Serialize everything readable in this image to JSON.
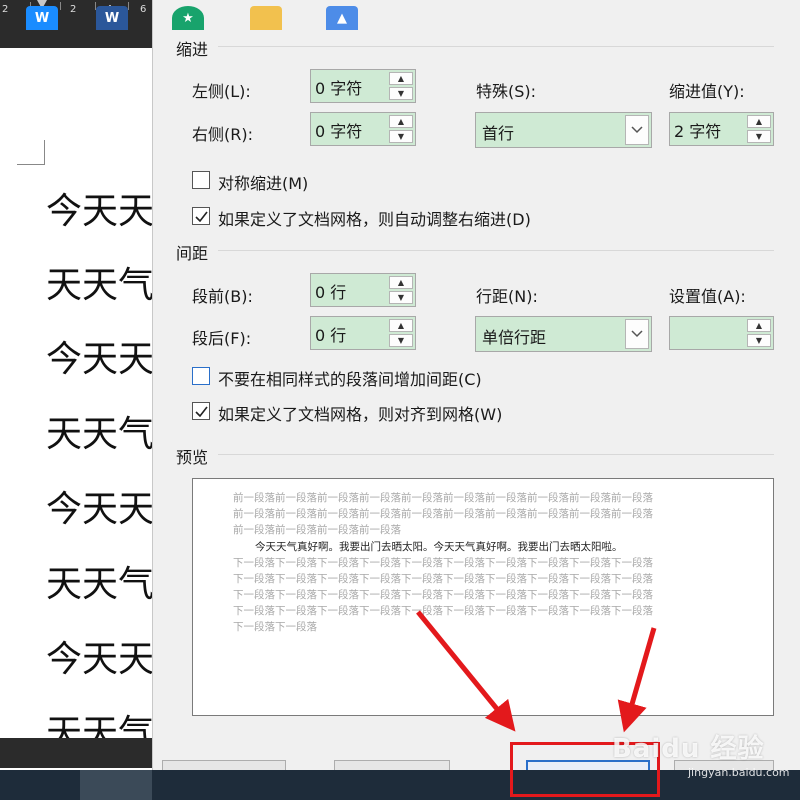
{
  "ruler": {
    "ticks": [
      "2",
      "2",
      "4",
      "6"
    ]
  },
  "document": {
    "lines": [
      "今天天",
      "天天气",
      "今天天",
      "天天气",
      "今天天",
      "天天气",
      "今天天",
      "天天气"
    ]
  },
  "indent": {
    "section_title": "缩进",
    "left_label": "左侧(L):",
    "left_value": "0 字符",
    "right_label": "右侧(R):",
    "right_value": "0 字符",
    "special_label": "特殊(S):",
    "special_value": "首行",
    "indent_value_label": "缩进值(Y):",
    "indent_value": "2 字符",
    "mirror_label": "对称缩进(M)",
    "mirror_checked": false,
    "auto_adjust_label": "如果定义了文档网格，则自动调整右缩进(D)",
    "auto_adjust_checked": true
  },
  "spacing": {
    "section_title": "间距",
    "before_label": "段前(B):",
    "before_value": "0 行",
    "after_label": "段后(F):",
    "after_value": "0 行",
    "line_spacing_label": "行距(N):",
    "line_spacing_value": "单倍行距",
    "setting_label": "设置值(A):",
    "setting_value": "",
    "no_space_label": "不要在相同样式的段落间增加间距(C)",
    "no_space_checked": false,
    "snap_grid_label": "如果定义了文档网格，则对齐到网格(W)",
    "snap_grid_checked": true
  },
  "preview": {
    "section_title": "预览",
    "prev_lines": [
      "前一段落前一段落前一段落前一段落前一段落前一段落前一段落前一段落前一段落前一段落",
      "前一段落前一段落前一段落前一段落前一段落前一段落前一段落前一段落前一段落前一段落",
      "前一段落前一段落前一段落前一段落"
    ],
    "main_line": "今天天气真好啊。我要出门去晒太阳。今天天气真好啊。我要出门去晒太阳啦。",
    "next_lines": [
      "下一段落下一段落下一段落下一段落下一段落下一段落下一段落下一段落下一段落下一段落",
      "下一段落下一段落下一段落下一段落下一段落下一段落下一段落下一段落下一段落下一段落",
      "下一段落下一段落下一段落下一段落下一段落下一段落下一段落下一段落下一段落下一段落",
      "下一段落下一段落下一段落下一段落下一段落下一段落下一段落下一段落下一段落下一段落",
      "下一段落下一段落"
    ]
  },
  "taskbar": {
    "items": [
      "wps-icon",
      "word-icon",
      "star-app-icon",
      "folder-icon",
      "photos-icon"
    ]
  },
  "watermark": {
    "main": "Baidu 经验",
    "sub": "jingyan.baidu.com"
  },
  "colors": {
    "field_bg": "#cfead4",
    "annotation_red": "#e3191c",
    "taskbar": "#1e2c3a"
  }
}
